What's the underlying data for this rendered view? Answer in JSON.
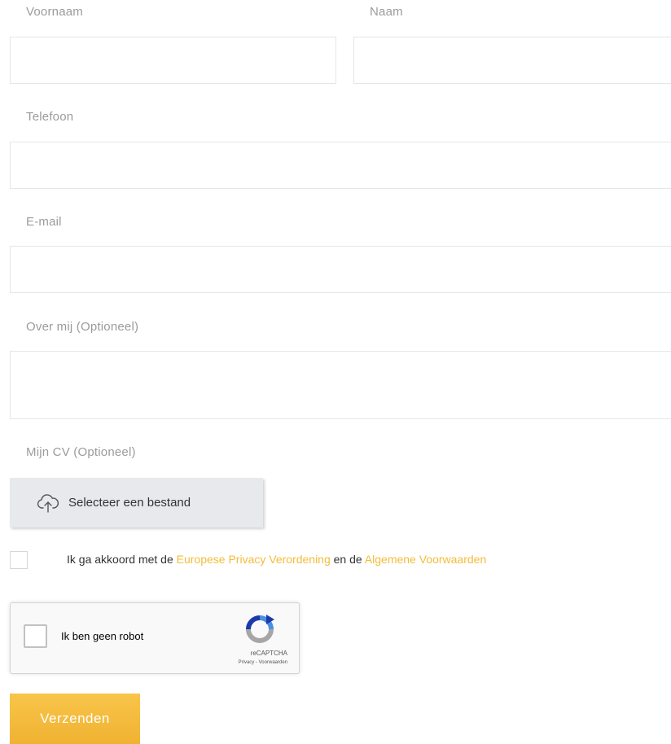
{
  "form": {
    "firstname": {
      "label": "Voornaam",
      "value": "",
      "placeholder": ""
    },
    "lastname": {
      "label": "Naam",
      "value": "",
      "placeholder": ""
    },
    "phone": {
      "label": "Telefoon",
      "value": "",
      "placeholder": ""
    },
    "email": {
      "label": "E-mail",
      "value": "",
      "placeholder": ""
    },
    "about": {
      "label": "Over mij (Optioneel)",
      "value": "",
      "placeholder": ""
    },
    "cv": {
      "label": "Mijn CV (Optioneel)",
      "button_label": "Selecteer een bestand",
      "icon": "cloud-upload-icon"
    },
    "consent": {
      "checked": false,
      "text_before": "Ik ga akkoord met de ",
      "link_privacy": "Europese Privacy Verordening",
      "text_middle": " en de ",
      "link_terms": "Algemene Voorwaarden"
    },
    "recaptcha": {
      "label": "Ik ben geen robot",
      "brand": "reCAPTCHA",
      "privacy": "Privacy",
      "separator": " - ",
      "terms": "Voorwaarden",
      "icon": "recaptcha-logo-icon"
    },
    "submit_label": "Verzenden"
  },
  "colors": {
    "accent": "#f2bd3a",
    "label": "#9b9b9b",
    "border": "#e6e6e6",
    "upload_bg": "#e8e9ed"
  }
}
